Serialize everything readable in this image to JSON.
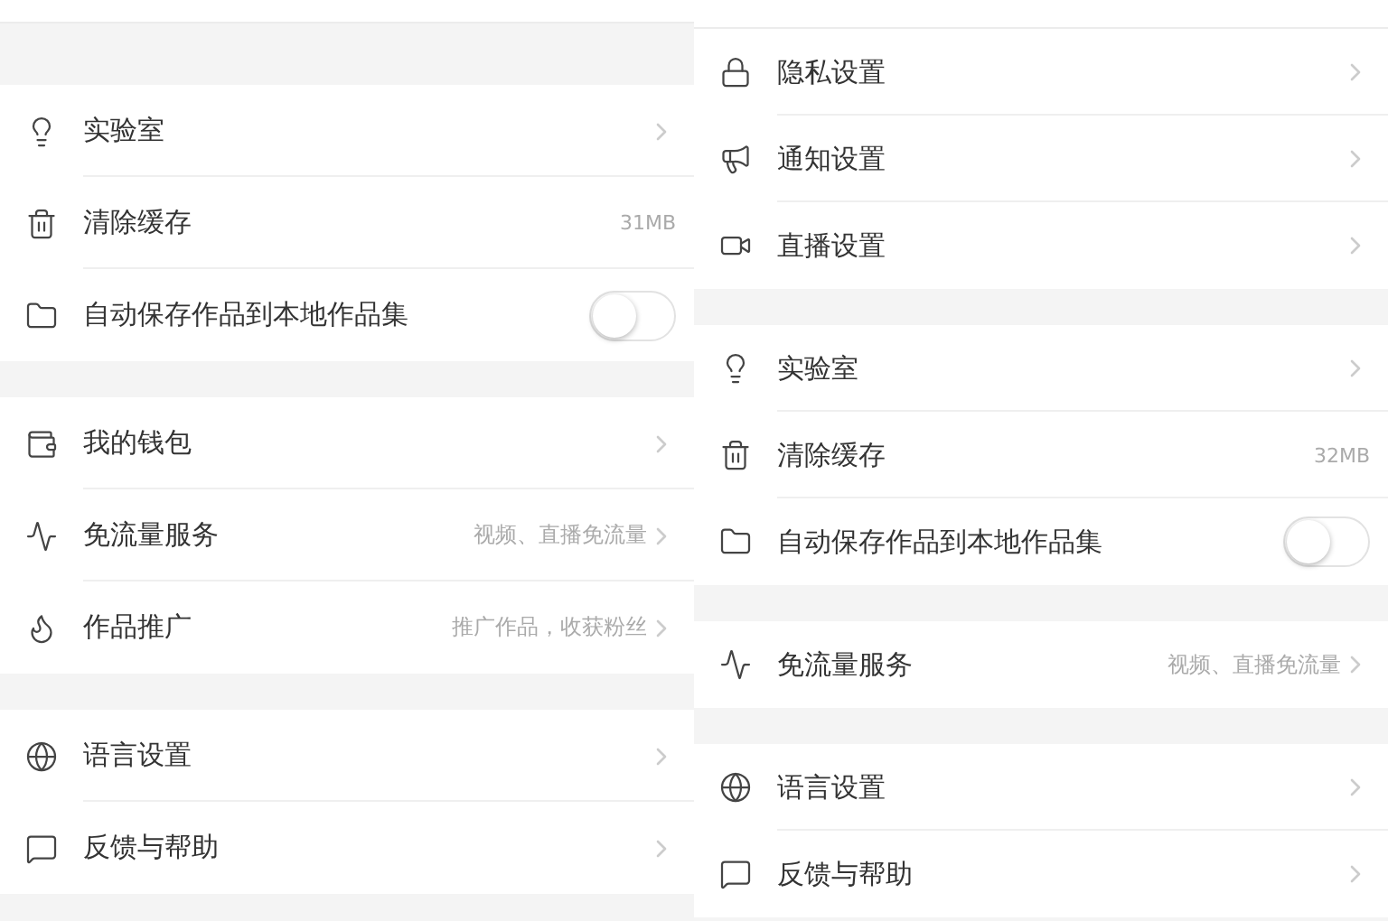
{
  "panels": [
    {
      "sections": [
        {
          "items": [
            {
              "kind": "chevron",
              "label": "实验室"
            },
            {
              "kind": "value",
              "label": "清除缓存",
              "value": "31MB"
            },
            {
              "kind": "toggle",
              "label": "自动保存作品到本地作品集",
              "on": false
            }
          ]
        },
        {
          "items": [
            {
              "kind": "chevron",
              "label": "我的钱包"
            },
            {
              "kind": "hint",
              "label": "免流量服务",
              "value": "视频、直播免流量"
            },
            {
              "kind": "hint",
              "label": "作品推广",
              "value": "推广作品，收获粉丝"
            }
          ]
        },
        {
          "items": [
            {
              "kind": "chevron",
              "label": "语言设置"
            },
            {
              "kind": "chevron",
              "label": "反馈与帮助"
            }
          ]
        }
      ]
    },
    {
      "sections": [
        {
          "items": [
            {
              "kind": "chevron",
              "label": "隐私设置"
            },
            {
              "kind": "chevron",
              "label": "通知设置"
            },
            {
              "kind": "chevron",
              "label": "直播设置"
            }
          ]
        },
        {
          "items": [
            {
              "kind": "chevron",
              "label": "实验室"
            },
            {
              "kind": "value",
              "label": "清除缓存",
              "value": "32MB"
            },
            {
              "kind": "toggle",
              "label": "自动保存作品到本地作品集",
              "on": false
            }
          ]
        },
        {
          "items": [
            {
              "kind": "hint",
              "label": "免流量服务",
              "value": "视频、直播免流量"
            }
          ]
        },
        {
          "items": [
            {
              "kind": "chevron",
              "label": "语言设置"
            },
            {
              "kind": "chevron",
              "label": "反馈与帮助"
            }
          ]
        }
      ]
    }
  ]
}
